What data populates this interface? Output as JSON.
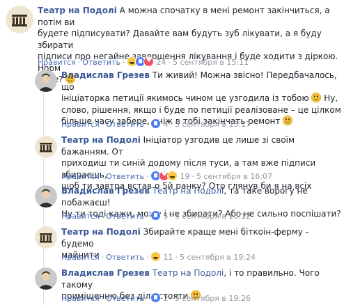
{
  "comments": [
    {
      "author": "Театр на Подолі",
      "lines": [
        "А можна спочатку в мені ремонт закінчиться, а потім ви",
        "будете підписувати? Давайте вам будуть зуб лікувати, а я буду збирати",
        "підписи про негайне завершення лікування і буде ходити з діркою. Норм",
        "буде?"
      ],
      "like": "Нравится",
      "reply": "Ответить",
      "reactions": [
        "haha",
        "like",
        "love"
      ],
      "reaction_count": "24",
      "time": "5 сентября в 15:11"
    },
    {
      "author": "Владислав Грезев",
      "lines": [
        "Ти живий! Можна звісно! Передбачалось, що",
        "ініціаторка петиції якимось чином це узгодила із тобою",
        "Ну,",
        "слово, рішення, якщо і буде по петиції реалізоване – це цілком",
        "більше часу забере, аніж в тобі закінчать ремонт"
      ],
      "like": "Нравится",
      "reply": "Ответить",
      "reaction_count": "4",
      "time": "5 сентября в 15:17"
    },
    {
      "author": "Театр на Подолі",
      "lines": [
        "Ініціатор узгодив це лише зі своїм бажанням. От",
        "приходиш ти синій додому після туси, а там вже підписи збираешь,",
        "щоб ти завтра встав о 5й ранку? Ото глянув би я на всіх"
      ],
      "like": "Нравится",
      "reply": "Ответить",
      "reaction_count": "19",
      "time": "5 сентября в 16:07"
    },
    {
      "author": "Владислав Грезев",
      "mention": "Театр на Подолі",
      "lines": [
        ", та таке ворогу не побажаєш!",
        "Ну ти тоді кажи, може і не збирати? Або не сильно поспішати?"
      ],
      "like": "Нравится",
      "reply": "Ответить",
      "reaction_count": "5",
      "time": "5 сентября в 16:12"
    },
    {
      "author": "Театр на Подолі",
      "lines": [
        "Збирайте краще мені біткоін-ферму - будемо",
        "майнити"
      ],
      "like": "Нравится",
      "reply": "Ответить",
      "reaction_count": "11",
      "time": "5 сентября в 19:24"
    },
    {
      "author": "Владислав Грезев",
      "mention": "Театр на Подолі",
      "lines": [
        ", і то правильно. Чого такому",
        "приміщенню без діла стояти"
      ],
      "like": "Нравится",
      "reply": "Ответить",
      "reaction_count": "2",
      "time": "5 сентября в 19:26"
    }
  ]
}
